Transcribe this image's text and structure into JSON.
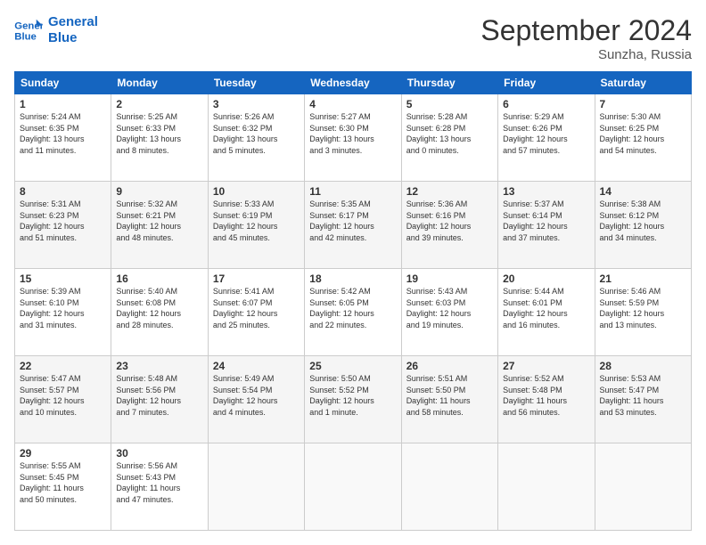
{
  "logo": {
    "line1": "General",
    "line2": "Blue"
  },
  "title": "September 2024",
  "subtitle": "Sunzha, Russia",
  "headers": [
    "Sunday",
    "Monday",
    "Tuesday",
    "Wednesday",
    "Thursday",
    "Friday",
    "Saturday"
  ],
  "weeks": [
    [
      {
        "day": "1",
        "info": "Sunrise: 5:24 AM\nSunset: 6:35 PM\nDaylight: 13 hours\nand 11 minutes."
      },
      {
        "day": "2",
        "info": "Sunrise: 5:25 AM\nSunset: 6:33 PM\nDaylight: 13 hours\nand 8 minutes."
      },
      {
        "day": "3",
        "info": "Sunrise: 5:26 AM\nSunset: 6:32 PM\nDaylight: 13 hours\nand 5 minutes."
      },
      {
        "day": "4",
        "info": "Sunrise: 5:27 AM\nSunset: 6:30 PM\nDaylight: 13 hours\nand 3 minutes."
      },
      {
        "day": "5",
        "info": "Sunrise: 5:28 AM\nSunset: 6:28 PM\nDaylight: 13 hours\nand 0 minutes."
      },
      {
        "day": "6",
        "info": "Sunrise: 5:29 AM\nSunset: 6:26 PM\nDaylight: 12 hours\nand 57 minutes."
      },
      {
        "day": "7",
        "info": "Sunrise: 5:30 AM\nSunset: 6:25 PM\nDaylight: 12 hours\nand 54 minutes."
      }
    ],
    [
      {
        "day": "8",
        "info": "Sunrise: 5:31 AM\nSunset: 6:23 PM\nDaylight: 12 hours\nand 51 minutes."
      },
      {
        "day": "9",
        "info": "Sunrise: 5:32 AM\nSunset: 6:21 PM\nDaylight: 12 hours\nand 48 minutes."
      },
      {
        "day": "10",
        "info": "Sunrise: 5:33 AM\nSunset: 6:19 PM\nDaylight: 12 hours\nand 45 minutes."
      },
      {
        "day": "11",
        "info": "Sunrise: 5:35 AM\nSunset: 6:17 PM\nDaylight: 12 hours\nand 42 minutes."
      },
      {
        "day": "12",
        "info": "Sunrise: 5:36 AM\nSunset: 6:16 PM\nDaylight: 12 hours\nand 39 minutes."
      },
      {
        "day": "13",
        "info": "Sunrise: 5:37 AM\nSunset: 6:14 PM\nDaylight: 12 hours\nand 37 minutes."
      },
      {
        "day": "14",
        "info": "Sunrise: 5:38 AM\nSunset: 6:12 PM\nDaylight: 12 hours\nand 34 minutes."
      }
    ],
    [
      {
        "day": "15",
        "info": "Sunrise: 5:39 AM\nSunset: 6:10 PM\nDaylight: 12 hours\nand 31 minutes."
      },
      {
        "day": "16",
        "info": "Sunrise: 5:40 AM\nSunset: 6:08 PM\nDaylight: 12 hours\nand 28 minutes."
      },
      {
        "day": "17",
        "info": "Sunrise: 5:41 AM\nSunset: 6:07 PM\nDaylight: 12 hours\nand 25 minutes."
      },
      {
        "day": "18",
        "info": "Sunrise: 5:42 AM\nSunset: 6:05 PM\nDaylight: 12 hours\nand 22 minutes."
      },
      {
        "day": "19",
        "info": "Sunrise: 5:43 AM\nSunset: 6:03 PM\nDaylight: 12 hours\nand 19 minutes."
      },
      {
        "day": "20",
        "info": "Sunrise: 5:44 AM\nSunset: 6:01 PM\nDaylight: 12 hours\nand 16 minutes."
      },
      {
        "day": "21",
        "info": "Sunrise: 5:46 AM\nSunset: 5:59 PM\nDaylight: 12 hours\nand 13 minutes."
      }
    ],
    [
      {
        "day": "22",
        "info": "Sunrise: 5:47 AM\nSunset: 5:57 PM\nDaylight: 12 hours\nand 10 minutes."
      },
      {
        "day": "23",
        "info": "Sunrise: 5:48 AM\nSunset: 5:56 PM\nDaylight: 12 hours\nand 7 minutes."
      },
      {
        "day": "24",
        "info": "Sunrise: 5:49 AM\nSunset: 5:54 PM\nDaylight: 12 hours\nand 4 minutes."
      },
      {
        "day": "25",
        "info": "Sunrise: 5:50 AM\nSunset: 5:52 PM\nDaylight: 12 hours\nand 1 minute."
      },
      {
        "day": "26",
        "info": "Sunrise: 5:51 AM\nSunset: 5:50 PM\nDaylight: 11 hours\nand 58 minutes."
      },
      {
        "day": "27",
        "info": "Sunrise: 5:52 AM\nSunset: 5:48 PM\nDaylight: 11 hours\nand 56 minutes."
      },
      {
        "day": "28",
        "info": "Sunrise: 5:53 AM\nSunset: 5:47 PM\nDaylight: 11 hours\nand 53 minutes."
      }
    ],
    [
      {
        "day": "29",
        "info": "Sunrise: 5:55 AM\nSunset: 5:45 PM\nDaylight: 11 hours\nand 50 minutes."
      },
      {
        "day": "30",
        "info": "Sunrise: 5:56 AM\nSunset: 5:43 PM\nDaylight: 11 hours\nand 47 minutes."
      },
      {
        "day": "",
        "info": ""
      },
      {
        "day": "",
        "info": ""
      },
      {
        "day": "",
        "info": ""
      },
      {
        "day": "",
        "info": ""
      },
      {
        "day": "",
        "info": ""
      }
    ]
  ]
}
